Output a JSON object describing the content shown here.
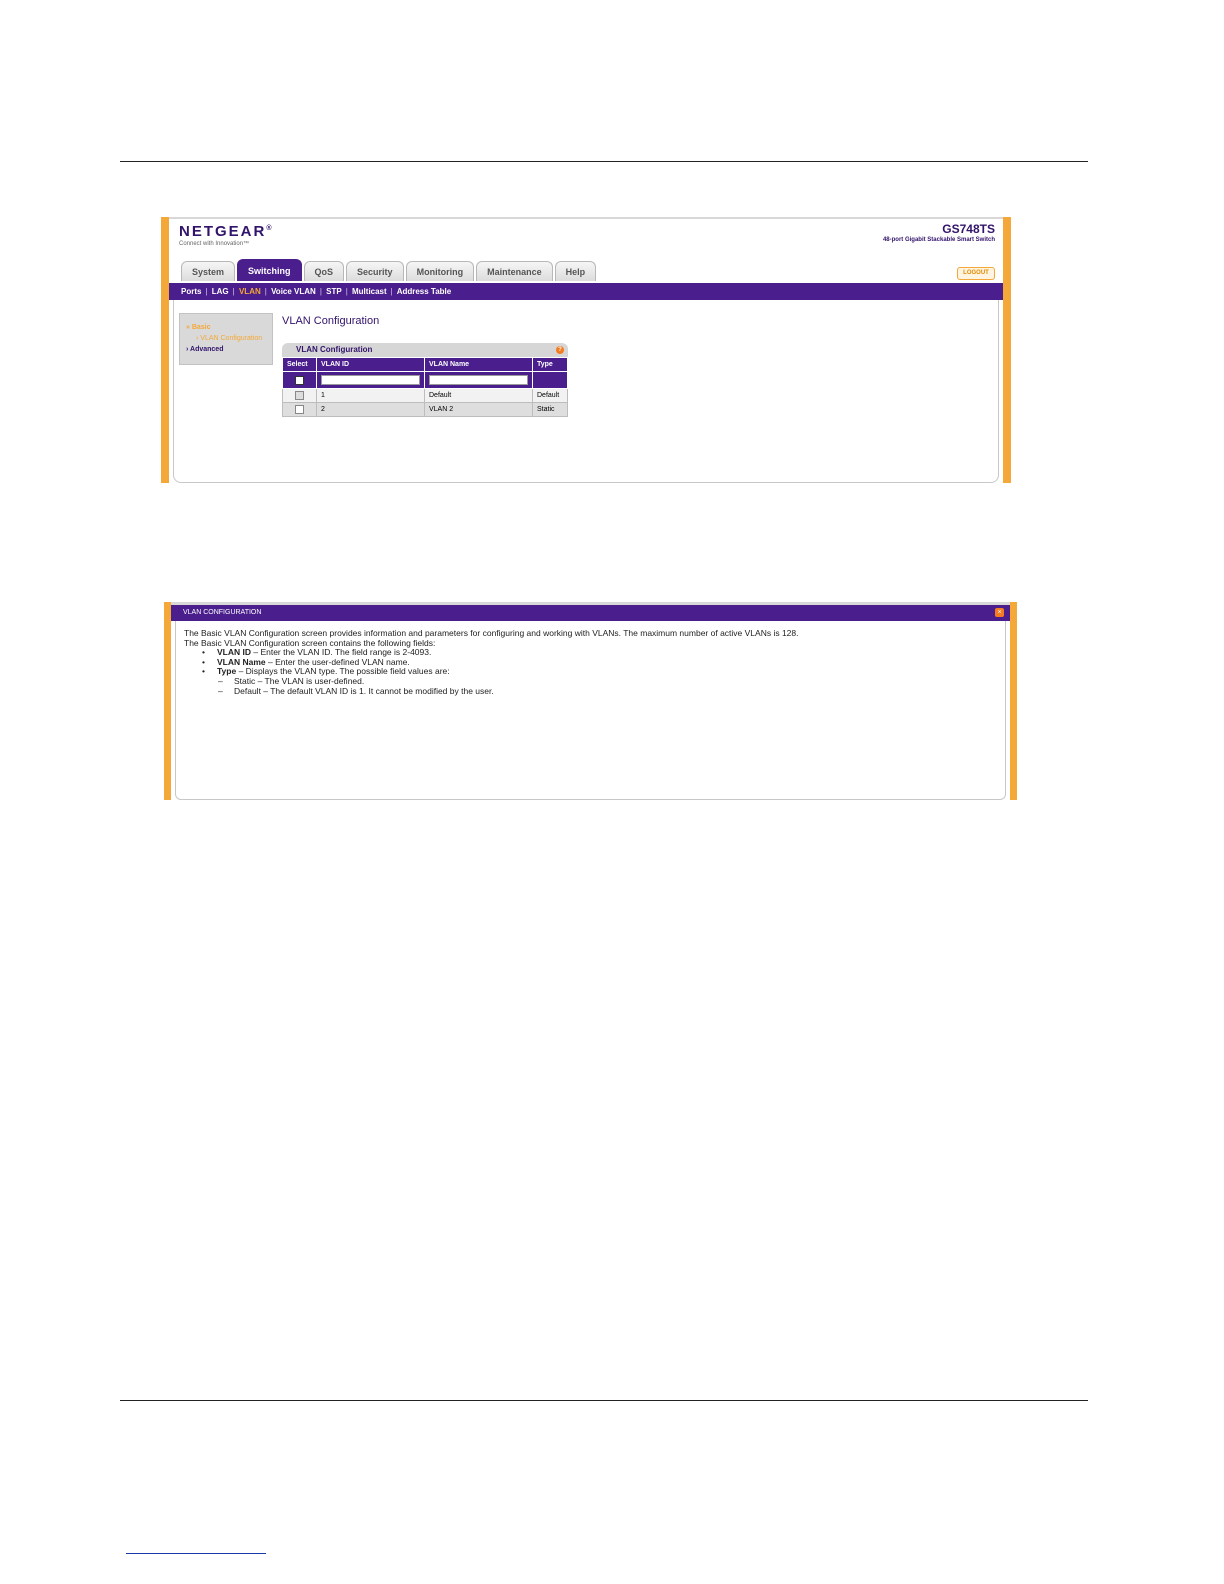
{
  "screenshot1": {
    "logo": "NETGEAR",
    "logo_registered": "®",
    "tagline": "Connect with Innovation™",
    "model": "GS748TS",
    "model_desc": "48-port Gigabit Stackable Smart Switch",
    "logout": "LOGOUT",
    "tabs": [
      "System",
      "Switching",
      "QoS",
      "Security",
      "Monitoring",
      "Maintenance",
      "Help"
    ],
    "active_tab": "Switching",
    "subnav": [
      "Ports",
      "LAG",
      "VLAN",
      "Voice VLAN",
      "STP",
      "Multicast",
      "Address Table"
    ],
    "active_subnav": "VLAN",
    "sidebar": {
      "basic": "» Basic",
      "vlan_config": "› VLAN Configuration",
      "advanced": "› Advanced"
    },
    "page_title": "VLAN Configuration",
    "panel_title": "VLAN Configuration",
    "help_glyph": "?",
    "columns": [
      "Select",
      "VLAN ID",
      "VLAN Name",
      "Type"
    ],
    "rows": [
      {
        "id": "1",
        "name": "Default",
        "type": "Default"
      },
      {
        "id": "2",
        "name": "VLAN 2",
        "type": "Static"
      }
    ]
  },
  "screenshot2": {
    "header": "VLAN CONFIGURATION",
    "close_glyph": "×",
    "line1": "The Basic VLAN Configuration screen provides information and parameters for configuring and working with VLANs. The maximum number of active VLANs is 128.",
    "line2": "The Basic VLAN Configuration screen contains the following fields:",
    "bullets": [
      {
        "term": "VLAN ID",
        "text": " – Enter the VLAN ID. The field range is 2-4093."
      },
      {
        "term": "VLAN Name",
        "text": " – Enter the user-defined VLAN name."
      },
      {
        "term": "Type",
        "text": " – Displays the VLAN type. The possible field values are:"
      }
    ],
    "subitems": [
      "Static – The VLAN is user-defined.",
      "Default – The default VLAN ID is 1. It cannot be modified by the user."
    ]
  }
}
